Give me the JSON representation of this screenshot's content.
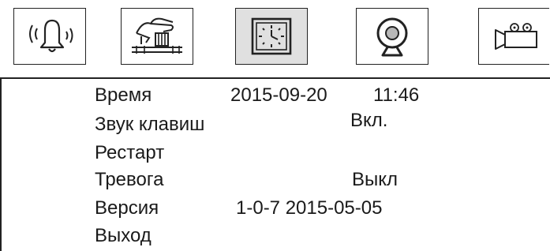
{
  "toolbar": {
    "items": [
      {
        "icon": "bell-icon",
        "selected": false
      },
      {
        "icon": "house-icon",
        "selected": false
      },
      {
        "icon": "clock-icon",
        "selected": true
      },
      {
        "icon": "security-camera-icon",
        "selected": false
      },
      {
        "icon": "video-camera-icon",
        "selected": false
      }
    ]
  },
  "menu": {
    "time": {
      "label": "Время",
      "date": "2015-09-20",
      "clock": "11:46"
    },
    "key_sound": {
      "label": "Звук клавиш",
      "value": "Вкл."
    },
    "restart": {
      "label": "Рестарт"
    },
    "alarm": {
      "label": "Тревога",
      "value": "Выкл"
    },
    "version": {
      "label": "Версия",
      "value": "1-0-7 2015-05-05"
    },
    "exit": {
      "label": "Выход"
    }
  },
  "colors": {
    "selected_background": "#e0e0e0",
    "border": "#222222",
    "text": "#1a1a1a"
  }
}
